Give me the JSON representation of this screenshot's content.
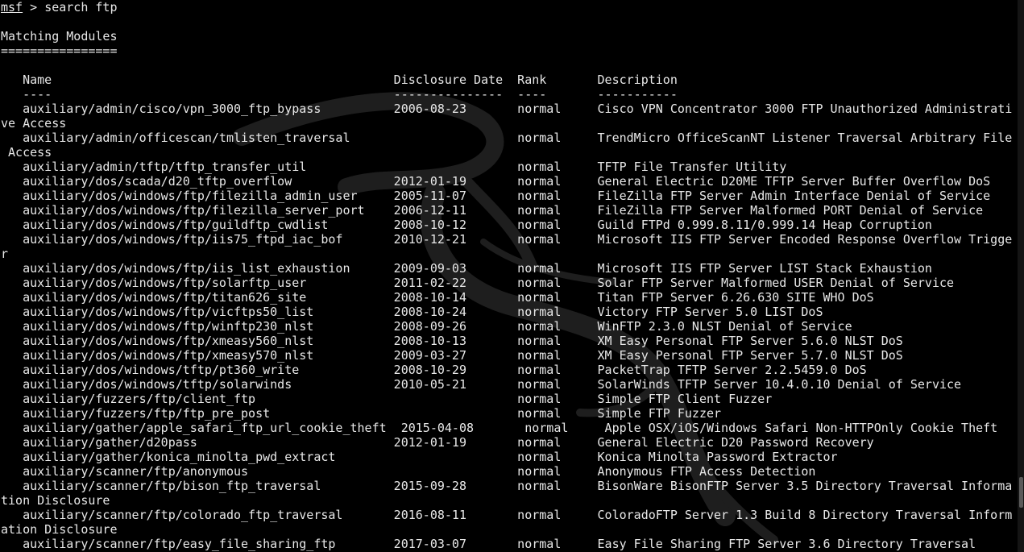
{
  "prompt": {
    "name": "msf",
    "separator": " > ",
    "command": "search ftp"
  },
  "lines": [
    "",
    "Matching Modules",
    "================",
    "",
    "   Name                                               Disclosure Date  Rank       Description",
    "   ----                                               ---------------  ----       -----------",
    "   auxiliary/admin/cisco/vpn_3000_ftp_bypass          2006-08-23       normal     Cisco VPN Concentrator 3000 FTP Unauthorized Administrati",
    "ve Access",
    "   auxiliary/admin/officescan/tmlisten_traversal                       normal     TrendMicro OfficeScanNT Listener Traversal Arbitrary File",
    " Access",
    "   auxiliary/admin/tftp/tftp_transfer_util                             normal     TFTP File Transfer Utility",
    "   auxiliary/dos/scada/d20_tftp_overflow              2012-01-19       normal     General Electric D20ME TFTP Server Buffer Overflow DoS",
    "   auxiliary/dos/windows/ftp/filezilla_admin_user     2005-11-07       normal     FileZilla FTP Server Admin Interface Denial of Service",
    "   auxiliary/dos/windows/ftp/filezilla_server_port    2006-12-11       normal     FileZilla FTP Server Malformed PORT Denial of Service",
    "   auxiliary/dos/windows/ftp/guildftp_cwdlist         2008-10-12       normal     Guild FTPd 0.999.8.11/0.999.14 Heap Corruption",
    "   auxiliary/dos/windows/ftp/iis75_ftpd_iac_bof       2010-12-21       normal     Microsoft IIS FTP Server Encoded Response Overflow Trigge",
    "r",
    "   auxiliary/dos/windows/ftp/iis_list_exhaustion      2009-09-03       normal     Microsoft IIS FTP Server LIST Stack Exhaustion",
    "   auxiliary/dos/windows/ftp/solarftp_user            2011-02-22       normal     Solar FTP Server Malformed USER Denial of Service",
    "   auxiliary/dos/windows/ftp/titan626_site            2008-10-14       normal     Titan FTP Server 6.26.630 SITE WHO DoS",
    "   auxiliary/dos/windows/ftp/vicftps50_list           2008-10-24       normal     Victory FTP Server 5.0 LIST DoS",
    "   auxiliary/dos/windows/ftp/winftp230_nlst           2008-09-26       normal     WinFTP 2.3.0 NLST Denial of Service",
    "   auxiliary/dos/windows/ftp/xmeasy560_nlst           2008-10-13       normal     XM Easy Personal FTP Server 5.6.0 NLST DoS",
    "   auxiliary/dos/windows/ftp/xmeasy570_nlst           2009-03-27       normal     XM Easy Personal FTP Server 5.7.0 NLST DoS",
    "   auxiliary/dos/windows/tftp/pt360_write             2008-10-29       normal     PacketTrap TFTP Server 2.2.5459.0 DoS",
    "   auxiliary/dos/windows/tftp/solarwinds              2010-05-21       normal     SolarWinds TFTP Server 10.4.0.10 Denial of Service",
    "   auxiliary/fuzzers/ftp/client_ftp                                    normal     Simple FTP Client Fuzzer",
    "   auxiliary/fuzzers/ftp/ftp_pre_post                                  normal     Simple FTP Fuzzer",
    "   auxiliary/gather/apple_safari_ftp_url_cookie_theft  2015-04-08       normal     Apple OSX/iOS/Windows Safari Non-HTTPOnly Cookie Theft",
    "   auxiliary/gather/d20pass                           2012-01-19       normal     General Electric D20 Password Recovery",
    "   auxiliary/gather/konica_minolta_pwd_extract                         normal     Konica Minolta Password Extractor",
    "   auxiliary/scanner/ftp/anonymous                                     normal     Anonymous FTP Access Detection",
    "   auxiliary/scanner/ftp/bison_ftp_traversal          2015-09-28       normal     BisonWare BisonFTP Server 3.5 Directory Traversal Informa",
    "tion Disclosure",
    "   auxiliary/scanner/ftp/colorado_ftp_traversal       2016-08-11       normal     ColoradoFTP Server 1.3 Build 8 Directory Traversal Inform",
    "ation Disclosure",
    "   auxiliary/scanner/ftp/easy_file_sharing_ftp        2017-03-07       normal     Easy File Sharing FTP Server 3.6 Directory Traversal"
  ],
  "colors": {
    "background": "#000000",
    "text": "#e8e8e8",
    "wallpaper_dragon": "#1e1e1e",
    "scrollbar_track": "#141414",
    "scrollbar_thumb": "#5a5a5a"
  },
  "wallpaper_icon": "kali-dragon-icon"
}
